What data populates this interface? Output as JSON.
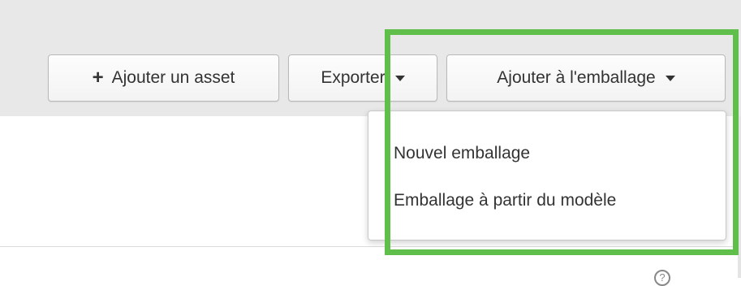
{
  "toolbar": {
    "add_asset_label": "Ajouter un asset",
    "add_icon": "plus-icon",
    "export_label": "Exporter",
    "add_to_packaging_label": "Ajouter à l'emballage",
    "caret_icon": "caret-down-icon"
  },
  "dropdown": {
    "items": [
      {
        "label": "Nouvel emballage"
      },
      {
        "label": "Emballage à partir du modèle"
      }
    ]
  },
  "annotation": {
    "highlight_color": "#5fbf4a"
  },
  "help": {
    "glyph": "?"
  }
}
